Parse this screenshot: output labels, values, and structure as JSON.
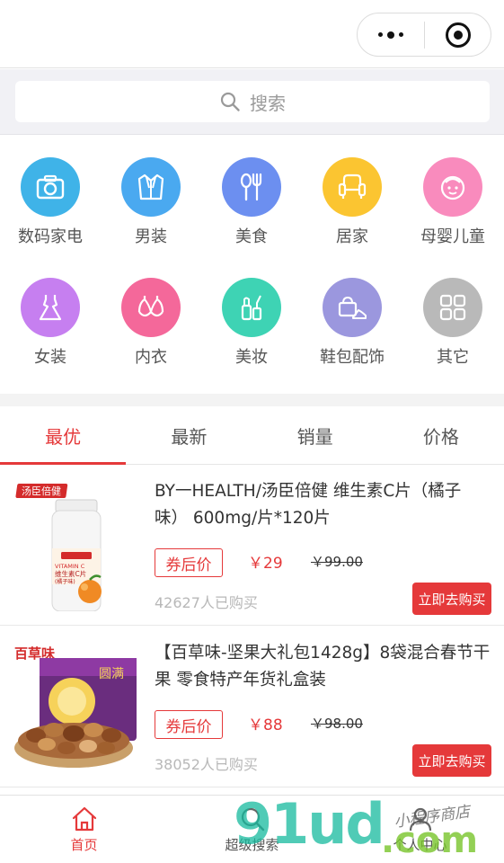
{
  "search": {
    "placeholder": "搜索"
  },
  "categories": [
    {
      "label": "数码家电",
      "icon": "camera-icon",
      "color": "#3fb3e8"
    },
    {
      "label": "男装",
      "icon": "suit-icon",
      "color": "#4aa9f0"
    },
    {
      "label": "美食",
      "icon": "fork-spoon-icon",
      "color": "#6c8ff0"
    },
    {
      "label": "居家",
      "icon": "armchair-icon",
      "color": "#fbc531"
    },
    {
      "label": "母婴儿童",
      "icon": "baby-face-icon",
      "color": "#f98bbd"
    },
    {
      "label": "女装",
      "icon": "dress-icon",
      "color": "#c67ff0"
    },
    {
      "label": "内衣",
      "icon": "bra-icon",
      "color": "#f4689a"
    },
    {
      "label": "美妆",
      "icon": "cosmetics-icon",
      "color": "#3ed3b4"
    },
    {
      "label": "鞋包配饰",
      "icon": "bag-shoe-icon",
      "color": "#9b97de"
    },
    {
      "label": "其它",
      "icon": "grid-icon",
      "color": "#b9b9b9"
    }
  ],
  "tabs": [
    {
      "label": "最优",
      "active": true
    },
    {
      "label": "最新",
      "active": false
    },
    {
      "label": "销量",
      "active": false
    },
    {
      "label": "价格",
      "active": false
    }
  ],
  "products": [
    {
      "title": "BY一HEALTH/汤臣倍健 维生素C片（橘子味） 600mg/片*120片",
      "coupon_label": "券后价",
      "price": "￥29",
      "original_price": "￥99.00",
      "sold": "42627人已购买",
      "buy_label": "立即去购买",
      "brand_text": "汤臣倍健",
      "bottle_lines": [
        "VITAMIN C",
        "维生素C片",
        "(橘子味)"
      ]
    },
    {
      "title": "【百草味-坚果大礼包1428g】8袋混合春节干果 零食特产年货礼盒装",
      "coupon_label": "券后价",
      "price": "￥88",
      "original_price": "￥98.00",
      "sold": "38052人已购买",
      "buy_label": "立即去购买",
      "brand_text": "百草味",
      "box_text": "圆满"
    }
  ],
  "tabbar": [
    {
      "label": "首页",
      "icon": "home-icon",
      "active": true
    },
    {
      "label": "超级搜索",
      "icon": "search-icon",
      "active": false
    },
    {
      "label": "个人中心",
      "icon": "user-icon",
      "active": false
    }
  ],
  "watermark": {
    "main": "91ud",
    "suffix": ".com",
    "handwriting": "小程序商店"
  },
  "colors": {
    "accent": "#e5393a",
    "bg_gray": "#f1f1f5"
  }
}
